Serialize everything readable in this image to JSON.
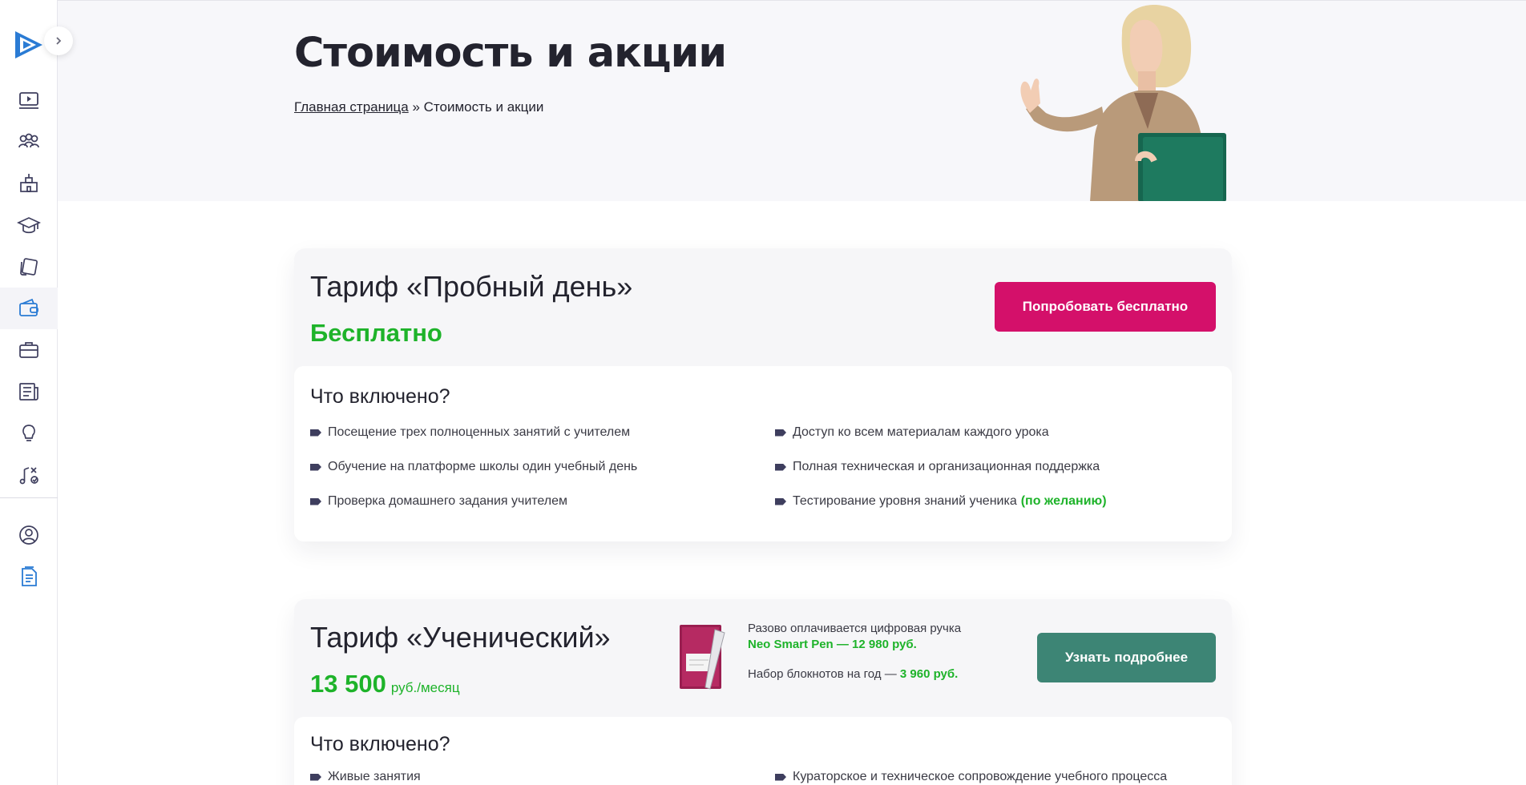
{
  "sidebar": {
    "expand_icon": "chevron-right-icon",
    "items": [
      {
        "icon": "video-lessons-icon"
      },
      {
        "icon": "teachers-group-icon"
      },
      {
        "icon": "school-building-icon"
      },
      {
        "icon": "graduation-cap-icon"
      },
      {
        "icon": "cards-icon"
      },
      {
        "icon": "wallet-icon",
        "active": true
      },
      {
        "icon": "briefcase-icon"
      },
      {
        "icon": "news-icon"
      },
      {
        "icon": "lightbulb-icon"
      },
      {
        "icon": "music-notes-icon"
      },
      {
        "icon": "user-profile-icon"
      },
      {
        "icon": "documents-icon"
      }
    ],
    "accent_color": "#2a7bd4"
  },
  "hero": {
    "title": "Стоимость и акции",
    "breadcrumb_home": "Главная страница",
    "breadcrumb_separator": "»",
    "breadcrumb_current": "Стоимость и акции"
  },
  "tariff_trial": {
    "title": "Тариф «Пробный день»",
    "price": "Бесплатно",
    "button": "Попробовать бесплатно",
    "included_title": "Что включено?",
    "features_left": [
      "Посещение трех полноценных занятий с учителем",
      "Обучение на платформе школы один учебный день",
      "Проверка домашнего задания учителем"
    ],
    "features_right": [
      "Доступ ко всем материалам каждого урока",
      "Полная техническая и организационная поддержка",
      "Тестирование уровня знаний ученика"
    ],
    "optional_note": "(по желанию)"
  },
  "tariff_student": {
    "title": "Тариф «Ученический»",
    "price": "13 500",
    "price_unit": "руб./месяц",
    "pen_text": "Разово оплачивается цифровая ручка",
    "pen_price": "Neo Smart Pen — 12 980 руб.",
    "notebook_text": "Набор блокнотов на год —",
    "notebook_price": "3 960 руб.",
    "button": "Узнать подробнее",
    "included_title": "Что включено?",
    "features_left": [
      "Живые занятия"
    ],
    "features_right": [
      "Кураторское и техническое сопровождение учебного процесса"
    ]
  },
  "colors": {
    "price_green": "#1eb32a",
    "button_pink": "#d4106a",
    "button_teal": "#3d8575",
    "title_dark": "#23232e"
  }
}
